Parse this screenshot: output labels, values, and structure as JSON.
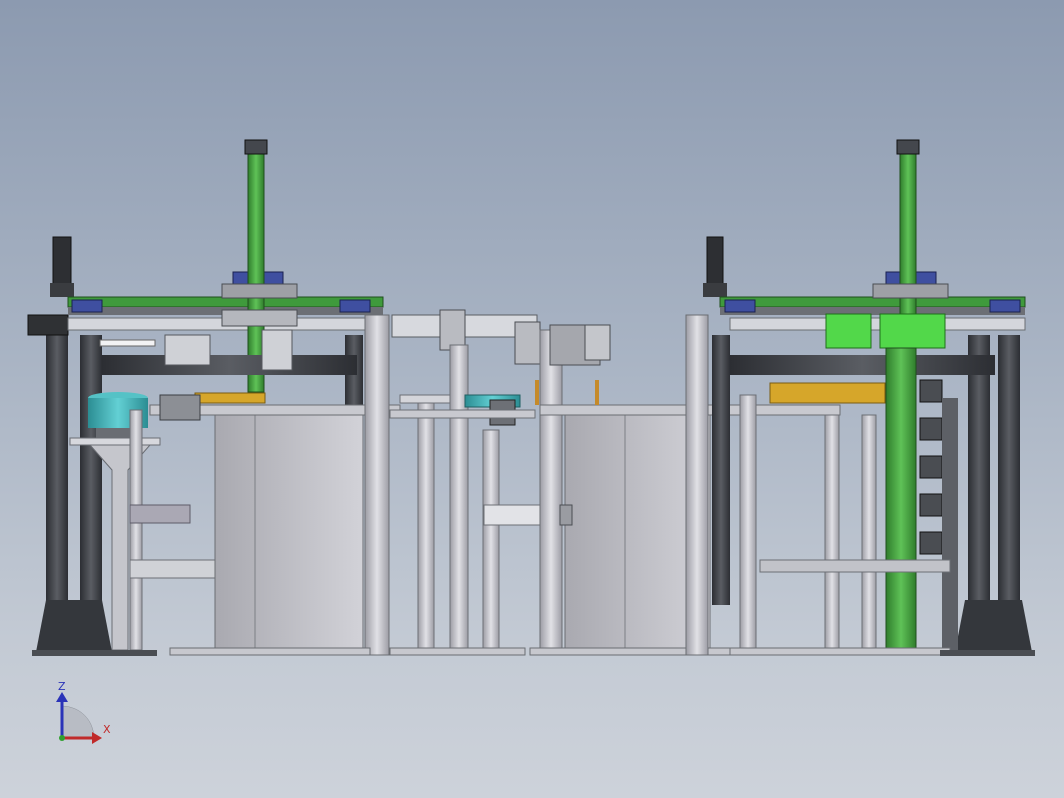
{
  "viewport": {
    "triad": {
      "z_label": "Z",
      "x_label": "X"
    }
  },
  "colors": {
    "frame_dark": "#3c3f44",
    "frame_light": "#c9c9cf",
    "profile_green": "#3f9a3c",
    "bright_green": "#52d84a",
    "cyan_part": "#3bb3b8",
    "yellow_part": "#d6a62a",
    "blue_part": "#3f4fa0"
  },
  "icons": [
    "coordinate-triad-icon"
  ]
}
